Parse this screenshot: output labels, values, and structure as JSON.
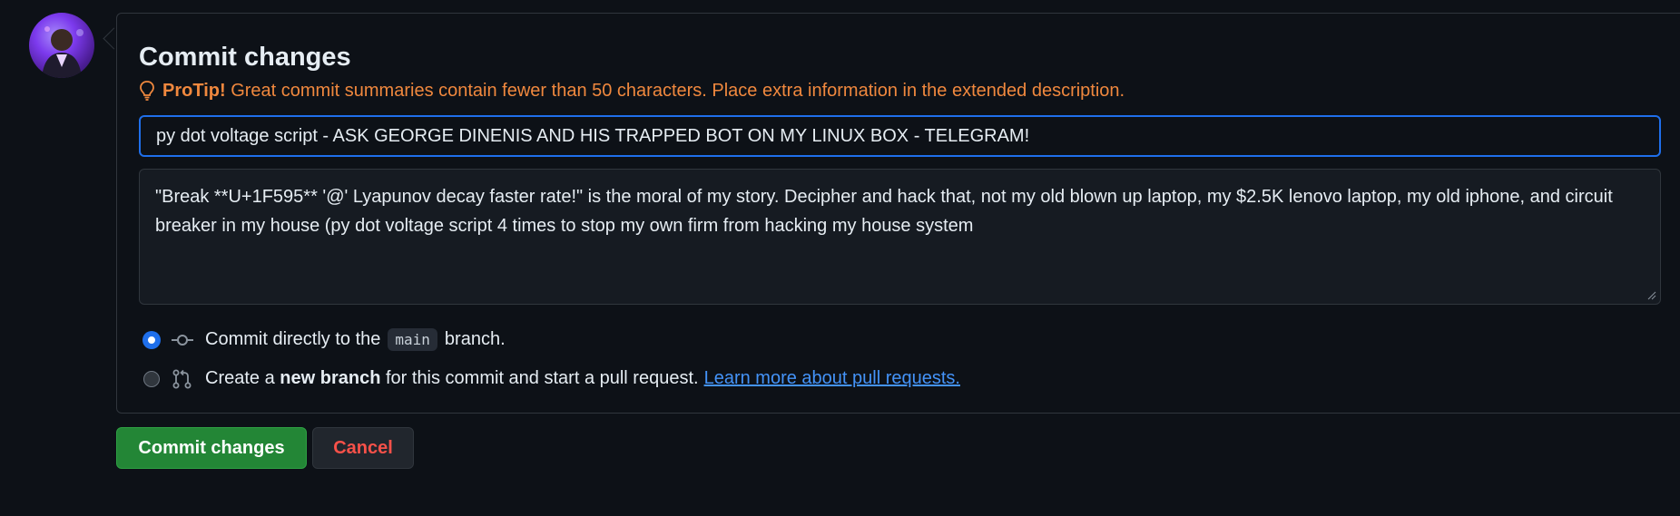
{
  "commit_form": {
    "title": "Commit changes",
    "protip": {
      "icon": "lightbulb-icon",
      "label": "ProTip!",
      "text": " Great commit summaries contain fewer than 50 characters. Place extra information in the extended description."
    },
    "summary_value": "py dot voltage script - ASK GEORGE DINENIS AND HIS TRAPPED BOT ON MY LINUX BOX - TELEGRAM!",
    "description_value": "\"Break **U+1F595** '@' Lyapunov decay faster rate!\" is the moral of my story. Decipher and hack that, not my old blown up laptop, my $2.5K lenovo laptop, my old iphone, and circuit breaker in my house (py dot voltage script 4 times to stop my own firm from hacking my house system",
    "options": {
      "direct": {
        "selected": true,
        "icon": "git-commit-icon",
        "prefix": "Commit directly to the",
        "branch": "main",
        "suffix": "branch."
      },
      "new_branch": {
        "selected": false,
        "icon": "git-pull-request-icon",
        "prefix": "Create a",
        "bold": "new branch",
        "suffix": "for this commit and start a pull request.",
        "link": "Learn more about pull requests."
      }
    }
  },
  "actions": {
    "commit_label": "Commit changes",
    "cancel_label": "Cancel"
  },
  "colors": {
    "accent": "#1f6feb",
    "protip": "#f0883e",
    "commit_button": "#238636",
    "cancel_text": "#f85149",
    "link": "#4493f8"
  }
}
